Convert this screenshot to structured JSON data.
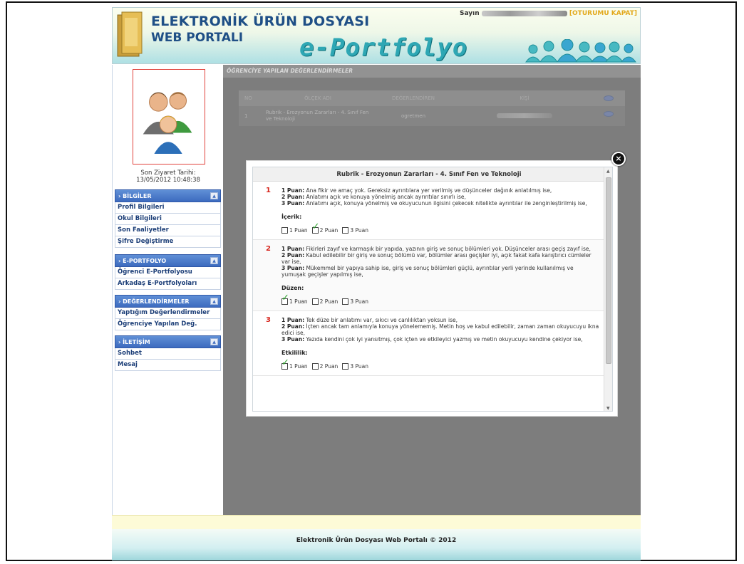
{
  "header": {
    "brand_line1": "ELEKTRONİK ÜRÜN DOSYASI",
    "brand_line2": "WEB PORTALI",
    "eportfolio_title": "e-Portfolyo",
    "session_greeting": "Sayın",
    "logout_label": "[OTURUMU KAPAT]"
  },
  "sidebar": {
    "last_visit_label": "Son Ziyaret Tarihi:",
    "last_visit_value": "13/05/2012 10:48:38",
    "menus": [
      {
        "title": "› BİLGİLER",
        "items": [
          "Profil Bilgileri",
          "Okul Bilgileri",
          "Son Faaliyetler",
          "Şifre Değiştirme"
        ]
      },
      {
        "title": "› E-PORTFOLYO",
        "items": [
          "Öğrenci E-Portfolyosu",
          "Arkadaş E-Portfolyoları"
        ]
      },
      {
        "title": "› DEĞERLENDİRMELER",
        "items": [
          "Yaptığım Değerlendirmeler",
          "Öğrenciye Yapılan Değ."
        ]
      },
      {
        "title": "› İLETİŞİM",
        "items": [
          "Sohbet",
          "Mesaj"
        ]
      }
    ]
  },
  "main": {
    "section_title": "ÖĞRENCİYE YAPILAN DEĞERLENDİRMELER",
    "table": {
      "headers": [
        "NO",
        "ÖLÇEK ADI",
        "DEĞERLENDİREN",
        "KİŞİ",
        ""
      ],
      "rows": [
        {
          "no": "1",
          "scale": "Rubrik - Erozyonun Zararları - 4. Sınıf Fen ve Teknoloji",
          "evaluator": "ogretmen"
        }
      ]
    }
  },
  "modal": {
    "title": "Rubrik - Erozyonun Zararları - 4. Sınıf Fen ve Teknoloji",
    "criteria": [
      {
        "number": "1",
        "lines": [
          {
            "key": "1 Puan:",
            "text": " Ana fikir ve amaç yok. Gereksiz ayrıntılara yer verilmiş ve düşünceler dağınık anlatılmış ise,"
          },
          {
            "key": "2 Puan:",
            "text": " Anlatımı açık ve konuya yönelmiş ancak ayrıntılar sınırlı ise,"
          },
          {
            "key": "3 Puan:",
            "text": " Anlatımı açık, konuya yönelmiş ve okuyucunun ilgisini çekecek nitelikte ayrıntılar ile zenginleştirilmiş ise,"
          }
        ],
        "title": "İçerik:",
        "options": [
          "1 Puan",
          "2 Puan",
          "3 Puan"
        ],
        "selected": 1
      },
      {
        "number": "2",
        "lines": [
          {
            "key": "1 Puan:",
            "text": " Fikirleri zayıf ve karmaşık bir yapıda, yazının giriş ve sonuç bölümleri yok. Düşünceler arası geçiş zayıf ise,"
          },
          {
            "key": "2 Puan:",
            "text": " Kabul edilebilir bir giriş ve sonuç bölümü var, bölümler arası geçişler iyi, açık fakat kafa karıştırıcı cümleler var ise,"
          },
          {
            "key": "3 Puan:",
            "text": " Mükemmel bir yapıya sahip ise, giriş ve sonuç bölümleri güçlü, ayrıntılar yerli yerinde kullanılmış ve yumuşak geçişler yapılmış ise,"
          }
        ],
        "title": "Düzen:",
        "options": [
          "1 Puan",
          "2 Puan",
          "3 Puan"
        ],
        "selected": 0
      },
      {
        "number": "3",
        "lines": [
          {
            "key": "1 Puan:",
            "text": " Tek düze bir anlatımı var, sıkıcı ve canlılıktan yoksun ise,"
          },
          {
            "key": "2 Puan:",
            "text": " İçten ancak tam anlamıyla konuya yönelememiş. Metin hoş ve kabul edilebilir, zaman zaman okuyucuyu ikna edici ise,"
          },
          {
            "key": "3 Puan:",
            "text": " Yazıda kendini çok iyi yansıtmış, çok içten ve etkileyici yazmış ve metin okuyucuyu kendine çekiyor ise,"
          }
        ],
        "title": "Etkililik:",
        "options": [
          "1 Puan",
          "2 Puan",
          "3 Puan"
        ],
        "selected": 0
      }
    ],
    "close_label": "×"
  },
  "footer": {
    "copyright": "Elektronik Ürün Dosyası Web Portalı © 2012"
  },
  "colors": {
    "accent_blue": "#3d6bbf",
    "number_red": "#d7261e",
    "check_green": "#2ea12e",
    "teal": "#2ea7b4"
  }
}
